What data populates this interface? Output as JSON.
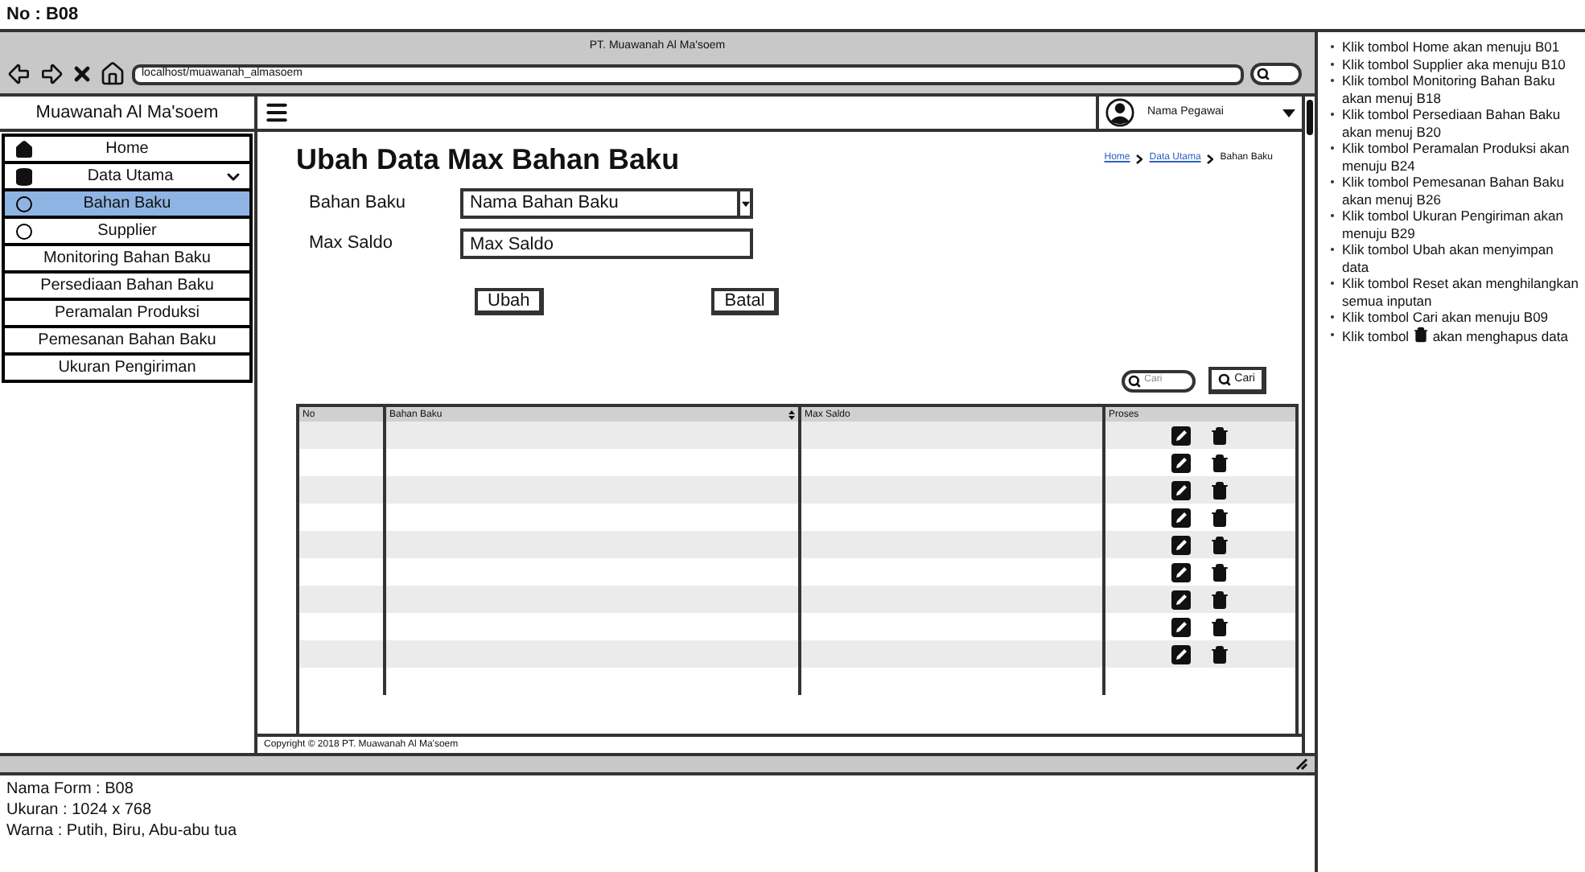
{
  "header": {
    "form_no": "No : B08"
  },
  "browser": {
    "title": "PT. Muawanah Al Ma'soem",
    "url": "localhost/muawanah_almasoem"
  },
  "sidebar": {
    "brand": "Muawanah Al Ma'soem",
    "items": [
      {
        "label": "Home",
        "kind": "home",
        "selected": false
      },
      {
        "label": "Data Utama",
        "kind": "group",
        "selected": false,
        "expanded": true
      },
      {
        "label": "Bahan Baku",
        "kind": "sub",
        "selected": true
      },
      {
        "label": "Supplier",
        "kind": "sub",
        "selected": false
      },
      {
        "label": "Monitoring Bahan Baku",
        "kind": "plain",
        "selected": false
      },
      {
        "label": "Persediaan Bahan Baku",
        "kind": "plain",
        "selected": false
      },
      {
        "label": "Peramalan Produksi",
        "kind": "plain",
        "selected": false
      },
      {
        "label": "Pemesanan Bahan Baku",
        "kind": "plain",
        "selected": false
      },
      {
        "label": "Ukuran Pengiriman",
        "kind": "plain",
        "selected": false
      }
    ]
  },
  "user": {
    "name": "Nama Pegawai"
  },
  "page": {
    "title": "Ubah Data Max Bahan Baku",
    "breadcrumb": [
      {
        "label": "Home",
        "link": true
      },
      {
        "label": "Data Utama",
        "link": true
      },
      {
        "label": "Bahan Baku",
        "link": false
      }
    ]
  },
  "form": {
    "fields": [
      {
        "label": "Bahan Baku",
        "kind": "select",
        "value": "Nama Bahan Baku"
      },
      {
        "label": "Max Saldo",
        "kind": "text",
        "placeholder": "Max Saldo"
      }
    ],
    "buttons": [
      "Ubah",
      "Batal"
    ]
  },
  "search": {
    "placeholder": "Cari",
    "button": "Cari"
  },
  "table": {
    "columns": [
      {
        "label": "No",
        "sortable": false
      },
      {
        "label": "Bahan Baku",
        "sortable": true
      },
      {
        "label": "Max Saldo",
        "sortable": false
      },
      {
        "label": "Proses",
        "sortable": false
      }
    ],
    "rows": [
      {
        "actions": true
      },
      {
        "actions": true
      },
      {
        "actions": true
      },
      {
        "actions": true
      },
      {
        "actions": true
      },
      {
        "actions": true
      },
      {
        "actions": true
      },
      {
        "actions": true
      },
      {
        "actions": true
      },
      {
        "actions": false
      }
    ]
  },
  "footer": {
    "copyright": "Copyright © 2018 PT. Muawanah Al Ma'soem"
  },
  "info": [
    "Nama Form : B08",
    "Ukuran : 1024 x 768",
    "Warna : Putih, Biru, Abu-abu tua"
  ],
  "notes": [
    {
      "kind": "text",
      "text": "Klik tombol Home akan menuju B01"
    },
    {
      "kind": "text",
      "text": "Klik tombol Supplier aka menuju B10"
    },
    {
      "kind": "text",
      "text": "Klik tombol Monitoring Bahan Baku akan menuj B18"
    },
    {
      "kind": "text",
      "text": "Klik tombol Persediaan Bahan Baku akan menuj B20"
    },
    {
      "kind": "text",
      "text": "Klik tombol Peramalan Produksi akan menuju B24"
    },
    {
      "kind": "text",
      "text": "Klik tombol Pemesanan Bahan Baku akan menuj B26"
    },
    {
      "kind": "text",
      "text": "Klik tombol Ukuran Pengiriman akan menuju B29"
    },
    {
      "kind": "text",
      "text": "Klik tombol Ubah akan menyimpan data"
    },
    {
      "kind": "text",
      "text": "Klik tombol Reset akan menghilangkan semua inputan"
    },
    {
      "kind": "text",
      "text": "Klik tombol Cari akan menuju B09"
    },
    {
      "kind": "icon",
      "before": "Klik tombol",
      "after": "akan menghapus data"
    }
  ]
}
